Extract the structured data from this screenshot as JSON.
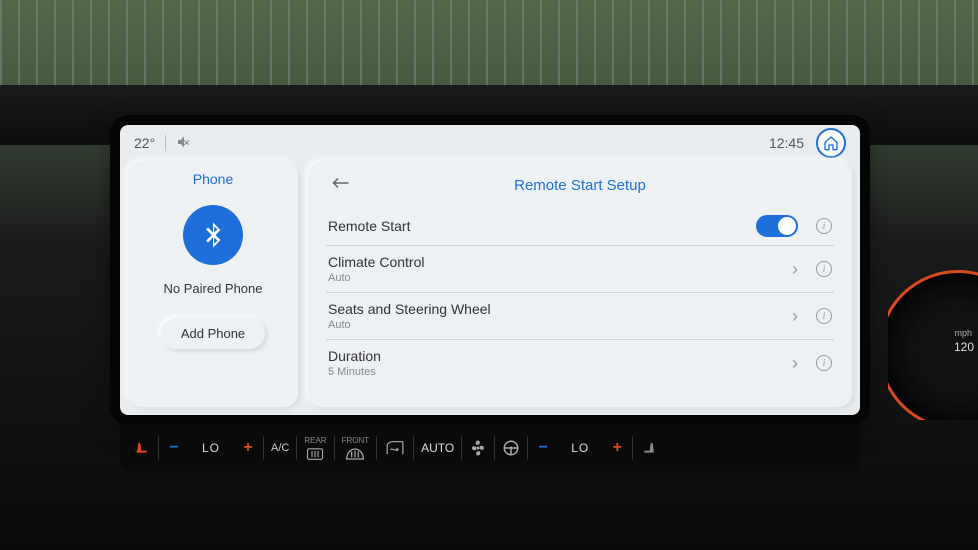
{
  "status": {
    "temperature": "22°",
    "clock": "12:45"
  },
  "phone_panel": {
    "title": "Phone",
    "status_text": "No Paired Phone",
    "add_button": "Add Phone"
  },
  "settings": {
    "title": "Remote Start Setup",
    "rows": [
      {
        "title": "Remote Start",
        "sub": "",
        "type": "toggle",
        "value": true
      },
      {
        "title": "Climate Control",
        "sub": "Auto",
        "type": "nav"
      },
      {
        "title": "Seats and Steering Wheel",
        "sub": "Auto",
        "type": "nav"
      },
      {
        "title": "Duration",
        "sub": "5 Minutes",
        "type": "nav"
      }
    ]
  },
  "climate": {
    "left_temp": "LO",
    "right_temp": "LO",
    "ac_label": "A/C",
    "rear_label": "REAR",
    "front_label": "FRONT",
    "auto_label": "AUTO"
  },
  "gauge": {
    "unit": "mph",
    "tick": "120"
  }
}
